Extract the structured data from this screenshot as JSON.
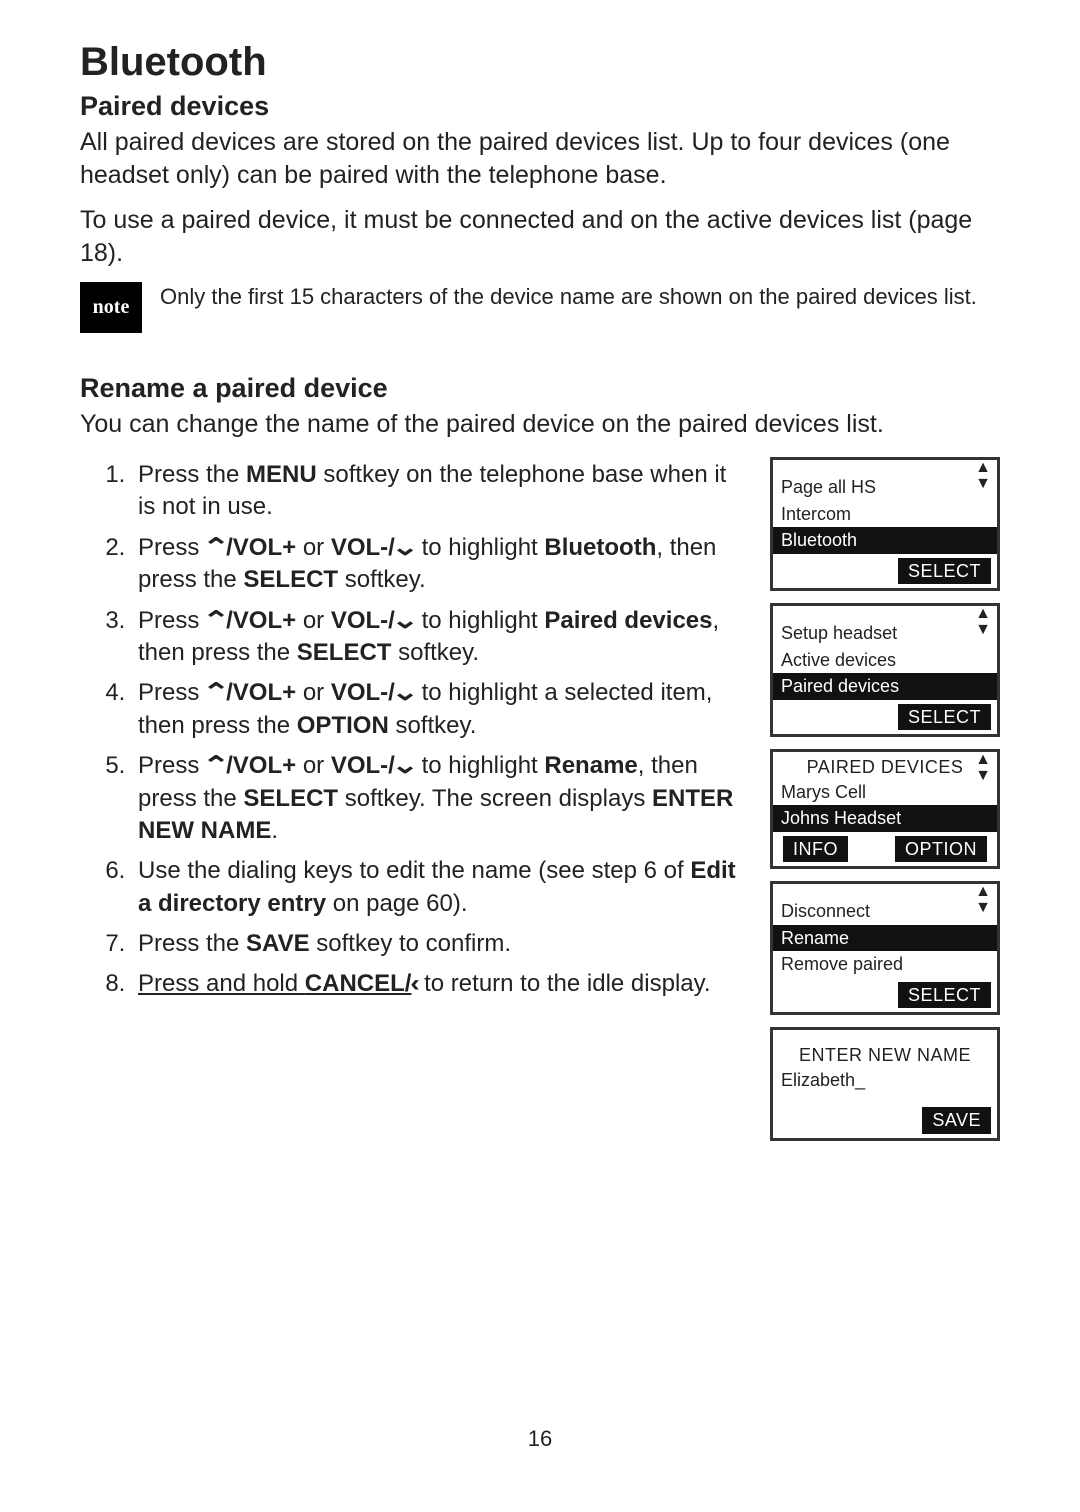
{
  "title": "Bluetooth",
  "section1_heading": "Paired devices",
  "section1_p1": "All paired devices are stored on the paired devices list. Up to four devices (one headset only) can be paired with the telephone base.",
  "section1_p2": "To use a paired device, it must be connected and on the active devices list (page 18).",
  "note_label": "note",
  "note_text": "Only the first 15 characters of the device name are shown on the paired devices list.",
  "section2_heading": "Rename a paired device",
  "section2_intro": "You can change the name of the paired device on the paired devices list.",
  "steps": {
    "s1a": "Press the ",
    "s1b": "MENU",
    "s1c": " softkey on the telephone base when it is not in use.",
    "s2a": "Press ",
    "s2vol": "/VOL+",
    "s2or": " or ",
    "s2vol2": "VOL-/",
    "s2b": " to highlight ",
    "s2c": "Bluetooth",
    "s2d": ", then press the ",
    "s2e": "SELECT",
    "s2f": " softkey.",
    "s3a": "Press ",
    "s3vol": "/VOL+",
    "s3or": " or ",
    "s3vol2": "VOL-/",
    "s3b": " to highlight ",
    "s3c": "Paired devices",
    "s3d": ", then press the ",
    "s3e": "SELECT",
    "s3f": " softkey.",
    "s4a": "Press ",
    "s4vol": "/VOL+",
    "s4or": " or ",
    "s4vol2": "VOL-/",
    "s4b": " to highlight a selected item, then press the ",
    "s4c": "OPTION",
    "s4d": " softkey.",
    "s5a": "Press ",
    "s5vol": "/VOL+",
    "s5or": " or ",
    "s5vol2": "VOL-/",
    "s5b": " to highlight ",
    "s5c": "Rename",
    "s5d": ", then press the ",
    "s5e": "SELECT",
    "s5f": " softkey. The screen displays ",
    "s5g": "ENTER NEW NAME",
    "s5h": ".",
    "s6a": "Use the dialing keys to edit the name (see step 6 of ",
    "s6b": "Edit a directory entry",
    "s6c": " on page 60).",
    "s7a": "Press the ",
    "s7b": "SAVE",
    "s7c": " softkey to confirm.",
    "s8a": "Press and hold ",
    "s8b": "CANCEL/",
    "s8c": " to return to the idle display."
  },
  "screens": {
    "sc1": {
      "r1": "Page all HS",
      "r2": "Intercom",
      "r3": "Bluetooth",
      "sk": "SELECT"
    },
    "sc2": {
      "r1": "Setup headset",
      "r2": "Active devices",
      "r3": "Paired devices",
      "sk": "SELECT"
    },
    "sc3": {
      "hdr": "PAIRED DEVICES",
      "r1": "Marys Cell",
      "r2": "Johns Headset",
      "sk1": "INFO",
      "sk2": "OPTION"
    },
    "sc4": {
      "r1": "Disconnect",
      "r2": "Rename",
      "r3": "Remove paired",
      "sk": "SELECT"
    },
    "sc5": {
      "hdr": "ENTER NEW NAME",
      "val": "Elizabeth",
      "sk": "SAVE"
    }
  },
  "page_number": "16"
}
